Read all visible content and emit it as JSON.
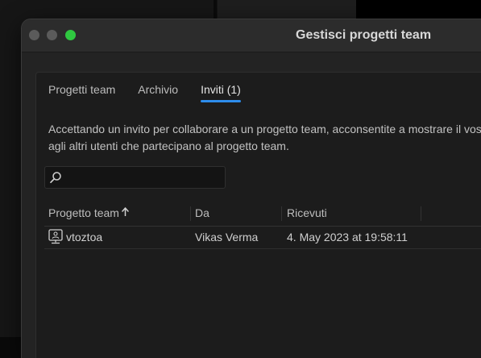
{
  "window": {
    "title": "Gestisci progetti team"
  },
  "tabs": [
    {
      "label": "Progetti team",
      "active": false
    },
    {
      "label": "Archivio",
      "active": false
    },
    {
      "label": "Inviti (1)",
      "active": true
    }
  ],
  "description": {
    "line1": "Accettando un invito per collaborare a un progetto team, acconsentite a mostrare il vostro nome e",
    "line2": "agli altri utenti che partecipano al progetto team."
  },
  "search": {
    "value": "",
    "placeholder": ""
  },
  "table": {
    "columns": [
      "Progetto team",
      "Da",
      "Ricevuti"
    ],
    "sort_column": "Progetto team",
    "sort_direction": "ascending",
    "rows": [
      {
        "project": "vtoztoa",
        "from": "Vikas Verma",
        "received": "4. May 2023 at 19:58:11"
      }
    ]
  },
  "colors": {
    "accent": "#2d8ceb",
    "zoom_button": "#2fc840",
    "window_bg": "#232323",
    "panel_bg": "#1c1c1c"
  },
  "icons": {
    "search": "search-icon",
    "sort": "arrow-up-icon",
    "project": "team-project-icon"
  }
}
